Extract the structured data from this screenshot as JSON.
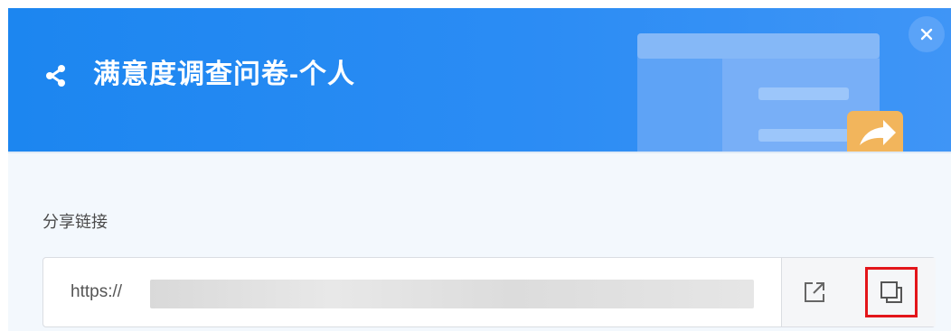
{
  "dialog": {
    "title": "满意度调查问卷-个人",
    "share_icon": "share-icon",
    "close_icon": "close-icon",
    "illustration": "share-forward-illustration"
  },
  "share_link": {
    "label": "分享链接",
    "url_visible_prefix": "https://",
    "open_icon": "external-link-icon",
    "copy_icon": "copy-icon"
  },
  "colors": {
    "header_blue": "#2b8cf4",
    "highlight_red": "#e3151a",
    "forward_badge": "#f2b55c"
  }
}
